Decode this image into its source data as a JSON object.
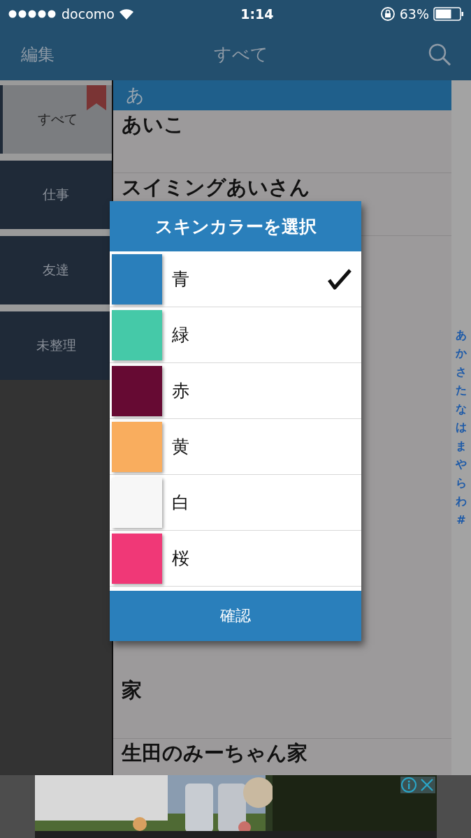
{
  "status_bar": {
    "carrier": "docomo",
    "time": "1:14",
    "battery": "63%"
  },
  "nav": {
    "edit": "編集",
    "title": "すべて"
  },
  "sidebar": {
    "items": [
      {
        "label": "すべて",
        "selected": true
      },
      {
        "label": "仕事",
        "selected": false
      },
      {
        "label": "友達",
        "selected": false
      },
      {
        "label": "未整理",
        "selected": false
      }
    ]
  },
  "list": {
    "section": "あ",
    "rows_above": [
      "あいこ",
      "スイミングあいさん"
    ],
    "rows_below": [
      "家",
      "生田のみーちゃん家"
    ]
  },
  "index": [
    "あ",
    "か",
    "さ",
    "た",
    "な",
    "は",
    "ま",
    "や",
    "ら",
    "わ",
    "#"
  ],
  "dialog": {
    "title": "スキンカラーを選択",
    "options": [
      {
        "label": "青",
        "color": "#2a7fbb",
        "selected": true
      },
      {
        "label": "緑",
        "color": "#45c9a8",
        "selected": false
      },
      {
        "label": "赤",
        "color": "#660a33",
        "selected": false
      },
      {
        "label": "黄",
        "color": "#f9ad5e",
        "selected": false
      },
      {
        "label": "白",
        "color": "#f7f7f7",
        "selected": false
      },
      {
        "label": "桜",
        "color": "#f03877",
        "selected": false
      }
    ],
    "confirm": "確認"
  }
}
